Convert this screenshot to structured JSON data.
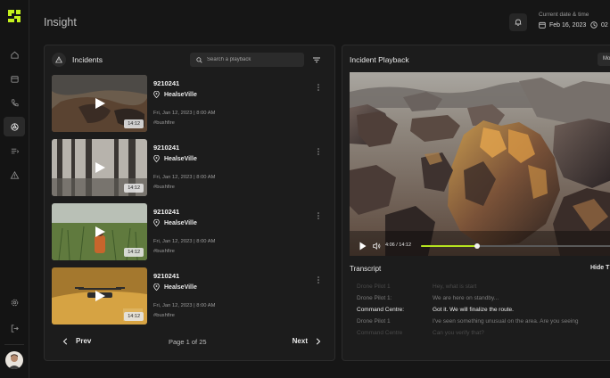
{
  "header": {
    "title": "Insight",
    "date_label": "Current date & time",
    "date": "Feb 16, 2023",
    "time": "02"
  },
  "incidents": {
    "title": "Incidents",
    "search_placeholder": "Search a playback",
    "items": [
      {
        "id": "9210241",
        "location": "HealseVille",
        "datetime": "Fri, Jan 12, 2023 | 8:00 AM",
        "tag": "#bushfire",
        "duration": "14:12",
        "scene": "canyon"
      },
      {
        "id": "9210241",
        "location": "HealseVille",
        "datetime": "Fri, Jan 12, 2023 | 8:00 AM",
        "tag": "#bushfire",
        "duration": "14:12",
        "scene": "forest"
      },
      {
        "id": "9210241",
        "location": "HealseVille",
        "datetime": "Fri, Jan 12, 2023 | 8:00 AM",
        "tag": "#bushfire",
        "duration": "14:12",
        "scene": "field"
      },
      {
        "id": "9210241",
        "location": "HealseVille",
        "datetime": "Fri, Jan 12, 2023 | 8:00 AM",
        "tag": "#bushfire",
        "duration": "14:12",
        "scene": "drone"
      }
    ],
    "pager": {
      "prev": "Prev",
      "next": "Next",
      "page": "Page 1 of 25"
    }
  },
  "playback": {
    "title": "Incident Playback",
    "more_label": "Mo",
    "current_time": "4:06 / 14:12",
    "progress": 0.29,
    "transcript_title": "Transcript",
    "hide_label": "Hide T",
    "transcript": [
      {
        "speaker": "Drone Pilot 1",
        "text": "Hey, what is start",
        "state": "faded"
      },
      {
        "speaker": "Drone Pilot 1:",
        "text": "We are here on standby...",
        "state": "dim"
      },
      {
        "speaker": "Command Centre:",
        "text": "Got it. We will finalize the route.",
        "state": "active"
      },
      {
        "speaker": "Drone Pilot 1",
        "text": "I've seen something unusual on the area. Are you seeing",
        "state": "dim"
      },
      {
        "speaker": "Command Centre",
        "text": "Can you verify that?",
        "state": "faded"
      }
    ]
  },
  "colors": {
    "accent": "#b5e31f",
    "background": "#161616",
    "panel": "#1c1c1c"
  }
}
